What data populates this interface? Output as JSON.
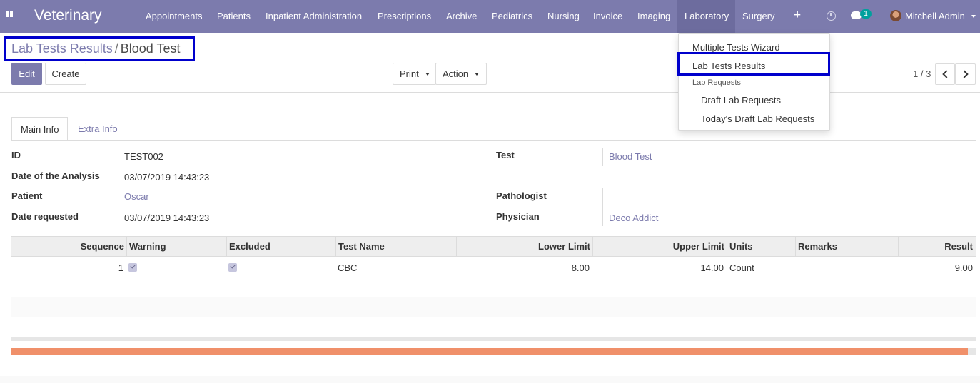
{
  "navbar": {
    "brand": "Veterinary",
    "menu": [
      "Appointments",
      "Patients",
      "Inpatient Administration",
      "Prescriptions",
      "Archive",
      "Pediatrics",
      "Nursing",
      "Invoice",
      "Imaging",
      "Laboratory",
      "Surgery"
    ],
    "active_menu": "Laboratory",
    "plus_label": "+",
    "chat_badge": "1",
    "user": "Mitchell Admin"
  },
  "breadcrumb": {
    "parent": "Lab Tests Results",
    "separator": "/",
    "current": "Blood Test"
  },
  "buttons": {
    "edit": "Edit",
    "create": "Create",
    "print": "Print",
    "action": "Action"
  },
  "pager": {
    "label": "1 / 3"
  },
  "dropdown": {
    "items": [
      "Multiple Tests Wizard",
      "Lab Tests Results"
    ],
    "highlighted": "Lab Tests Results",
    "section_header": "Lab Requests",
    "sub_items": [
      "Draft Lab Requests",
      "Today's Draft Lab Requests"
    ]
  },
  "tabs": [
    "Main Info",
    "Extra Info"
  ],
  "form": {
    "left": [
      {
        "label": "ID",
        "value": "TEST002",
        "link": false
      },
      {
        "label": "Date of the Analysis",
        "value": "03/07/2019 14:43:23",
        "link": false
      },
      {
        "label": "Patient",
        "value": "Oscar",
        "link": true
      },
      {
        "label": "Date requested",
        "value": "03/07/2019 14:43:23",
        "link": false
      }
    ],
    "right": [
      {
        "label": "Test",
        "value": "Blood Test",
        "link": true
      },
      {
        "label": "Pathologist",
        "value": "",
        "link": false
      },
      {
        "label": "Physician",
        "value": "Deco Addict",
        "link": true
      }
    ]
  },
  "table": {
    "columns": [
      "Sequence",
      "Warning",
      "Excluded",
      "Test Name",
      "Lower Limit",
      "Upper Limit",
      "Units",
      "Remarks",
      "Result"
    ],
    "rows": [
      {
        "sequence": "1",
        "warning": true,
        "excluded": true,
        "test_name": "CBC",
        "lower_limit": "8.00",
        "upper_limit": "14.00",
        "units": "Count",
        "remarks": "",
        "result": "9.00"
      }
    ]
  },
  "progress": {
    "fraction": 0.992
  },
  "colors": {
    "brand": "#7c7bad",
    "highlight_border": "#0000cc",
    "progress": "#f0906a",
    "badge": "#00a09d"
  }
}
